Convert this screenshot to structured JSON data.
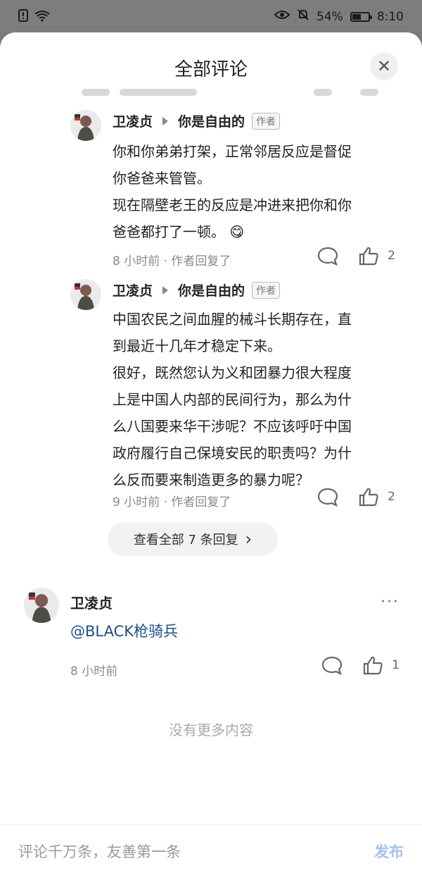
{
  "status_bar": {
    "battery": "54%",
    "battery_level": 0.54,
    "time": "8:10"
  },
  "sheet": {
    "title": "全部评论",
    "close_icon": "close-icon"
  },
  "replies": [
    {
      "author": "卫凌贞",
      "reply_to": "你是自由的",
      "badge": "作者",
      "lines": [
        "你和你弟弟打架，正常邻居反应是督促",
        "你爸爸来管管。",
        "现在隔壁老王的反应是冲进来把你和你",
        "爸爸都打了一顿。"
      ],
      "emoji": "😋",
      "meta": "8 小时前 · 作者回复了",
      "likes": "2"
    },
    {
      "author": "卫凌贞",
      "reply_to": "你是自由的",
      "badge": "作者",
      "lines": [
        "中国农民之间血腥的械斗长期存在，直",
        "到最近十几年才稳定下来。",
        "很好，既然您认为义和团暴力很大程度",
        "上是中国人内部的民间行为，那么为什",
        "么八国要来华干涉呢？不应该呼吁中国",
        "政府履行自己保境安民的职责吗？为什",
        "么反而要来制造更多的暴力呢？"
      ],
      "meta": "9 小时前 · 作者回复了",
      "likes": "2"
    }
  ],
  "view_all": {
    "label": "查看全部 7 条回复",
    "chevron": "›"
  },
  "comment": {
    "author": "卫凌贞",
    "more": "···",
    "mention": "@BLACK枪骑兵",
    "meta": "8 小时前",
    "likes": "1"
  },
  "footer_note": "没有更多内容",
  "bottom": {
    "placeholder": "评论千万条，友善第一条",
    "publish": "发布"
  },
  "colors": {
    "link": "#1f4f86",
    "publish": "#9fc3ef"
  }
}
